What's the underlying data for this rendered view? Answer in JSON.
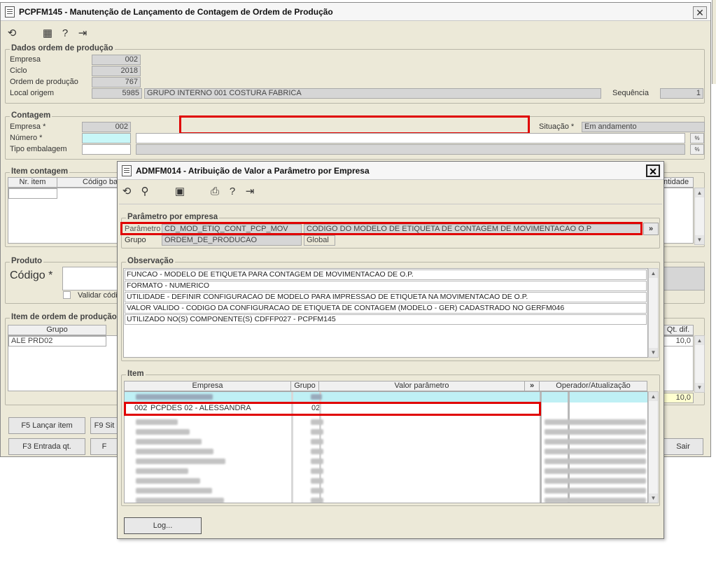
{
  "main": {
    "title": "PCPFM145 - Manutenção de Lançamento de Contagem de Ordem de Produção",
    "close": "✕",
    "dados": {
      "title": "Dados ordem de produção",
      "empresa_label": "Empresa",
      "empresa": "002",
      "ciclo_label": "Ciclo",
      "ciclo": "2018",
      "ordem_label": "Ordem de produção",
      "ordem": "767",
      "local_label": "Local origem",
      "local_code": "5985",
      "local_name": "GRUPO INTERNO 001 COSTURA FABRICA",
      "sequencia_label": "Sequência",
      "sequencia": "1"
    },
    "contagem": {
      "title": "Contagem",
      "empresa_label": "Empresa *",
      "empresa": "002",
      "numero_label": "Número *",
      "tipo_label": "Tipo embalagem",
      "situacao_label": "Situação *",
      "situacao": "Em andamento"
    },
    "item_contagem": {
      "title": "Item contagem",
      "col_nr": "Nr. item",
      "col_codigo": "Código ba",
      "col_qtd": "ntidade"
    },
    "produto": {
      "title": "Produto",
      "codigo_label": "Código *",
      "validar_label": "Validar códi"
    },
    "item_ordem": {
      "title": "Item de ordem de produção",
      "col_grupo": "Grupo",
      "col_qt": "Qt. dif.",
      "row_grupo": "ALE PRD02",
      "row_val": "10,0",
      "total_val": "10,0"
    },
    "buttons": {
      "f5": "F5 Lançar item",
      "f9": "F9 Sit",
      "f3": "F3 Entrada qt.",
      "f_other": "F",
      "sair": "Sair"
    }
  },
  "dialog": {
    "title": "ADMFM014 - Atribuição de Valor a Parâmetro por Empresa",
    "close": "✕",
    "param": {
      "title": "Parâmetro por empresa",
      "parametro_label": "Parâmetro",
      "parametro": "CD_MOD_ETIQ_CONT_PCP_MOV",
      "descricao": "CODIGO DO MODELO DE ETIQUETA DE CONTAGEM DE MOVIMENTACAO O.P",
      "grupo_label": "Grupo",
      "grupo": "ORDEM_DE_PRODUCAO",
      "escopo": "Global",
      "more": "»"
    },
    "obs": {
      "title": "Observação",
      "lines": [
        "FUNCAO - MODELO DE ETIQUETA PARA CONTAGEM DE MOVIMENTACAO DE O.P.",
        "FORMATO - NUMERICO",
        "UTILIDADE - DEFINIR CONFIGURACAO DE MODELO PARA IMPRESSAO DE ETIQUETA NA MOVIMENTACAO DE O.P.",
        "VALOR VALIDO - CODIGO DA CONFIGURACAO DE ETIQUETA DE CONTAGEM (MODELO - GER) CADASTRADO NO GERFM046",
        "UTILIZADO NO(S) COMPONENTE(S) CDFFP027 - PCPFM145"
      ]
    },
    "item": {
      "title": "Item",
      "col_empresa": "Empresa",
      "col_grupo": "Grupo",
      "col_valor": "Valor parâmetro",
      "col_more": "»",
      "col_operador": "Operador/Atualização",
      "highlight_code": "002",
      "highlight_name": "PCPDES 02 - ALESSANDRA",
      "highlight_grupo": "02"
    },
    "log_button": "Log..."
  },
  "colors": {
    "highlight": "#e00000",
    "required_field": "#c8f7f8",
    "window_bg": "#ece9d8"
  }
}
